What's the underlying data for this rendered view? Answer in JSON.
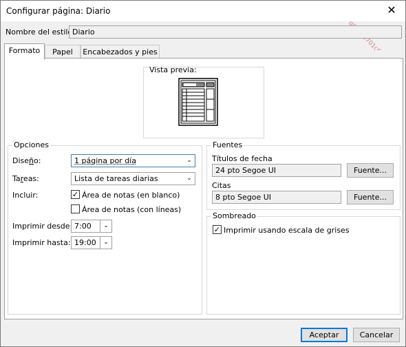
{
  "window": {
    "title": "Configurar página: Diario",
    "close_glyph": "✕"
  },
  "watermark": "d03bd6701c6a39",
  "style_name": {
    "label": "Nombre del estilo:",
    "value": "Diario"
  },
  "tabs": [
    {
      "label": "Formato",
      "active": true
    },
    {
      "label": "Papel",
      "active": false
    },
    {
      "label": "Encabezados y pies",
      "active": false
    }
  ],
  "preview": {
    "label": "Vista previa:"
  },
  "options": {
    "title": "Opciones",
    "layout": {
      "label": "Diseño:",
      "value": "1 página por día"
    },
    "tasks": {
      "label": "Tareas:",
      "value": "Lista de tareas diarias"
    },
    "include": {
      "label": "Incluir:"
    },
    "notes_blank": {
      "label": "Área de notas (en blanco)",
      "checked": true
    },
    "notes_lined": {
      "label": "Área de notas (con líneas)",
      "checked": false
    },
    "print_from": {
      "label": "Imprimir desde:",
      "value": "7:00"
    },
    "print_to": {
      "label": "Imprimir hasta:",
      "value": "19:00"
    }
  },
  "fonts": {
    "title": "Fuentes",
    "date_headings": {
      "label": "Títulos de fecha",
      "value": "24 pto Segoe UI",
      "button": "Fuente..."
    },
    "appointments": {
      "label": "Citas",
      "value": "8 pto Segoe UI",
      "button": "Fuente..."
    }
  },
  "shading": {
    "title": "Sombreado",
    "grayscale": {
      "label": "Imprimir usando escala de grises",
      "checked": true
    }
  },
  "footer": {
    "ok": "Aceptar",
    "cancel": "Cancelar"
  },
  "icons": {
    "close": "close-icon",
    "dropdown": "chevron-down-icon",
    "check": "checkmark-icon",
    "preview": "page-preview-icon"
  }
}
